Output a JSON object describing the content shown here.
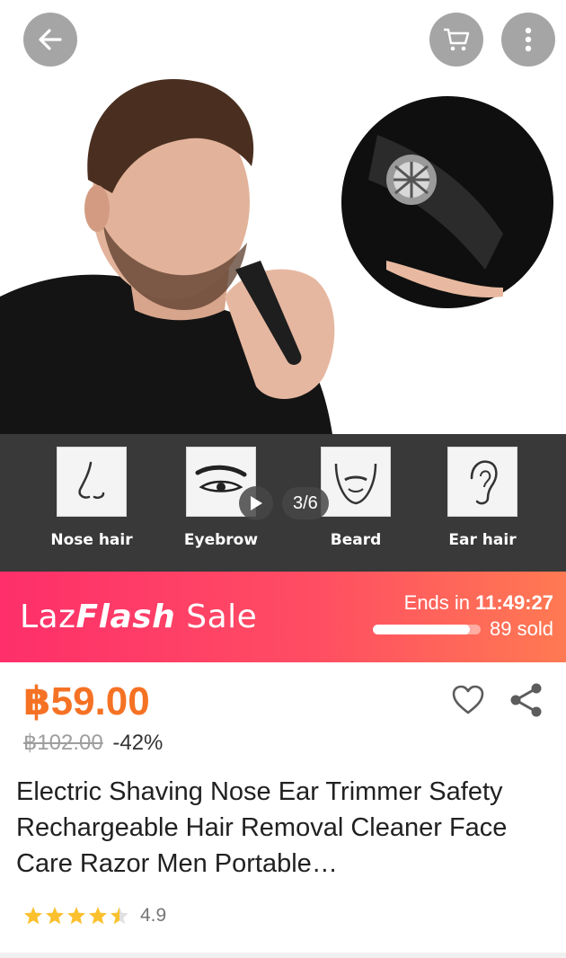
{
  "toolbar": {
    "back_icon": "arrow-left-icon",
    "cart_icon": "cart-icon",
    "more_icon": "vertical-dots-icon"
  },
  "gallery": {
    "counter": "3/6",
    "features": [
      {
        "label": "Nose hair",
        "icon": "nose-icon"
      },
      {
        "label": "Eyebrow",
        "icon": "eyebrow-icon"
      },
      {
        "label": "Beard",
        "icon": "beard-icon"
      },
      {
        "label": "Ear hair",
        "icon": "ear-icon"
      }
    ]
  },
  "flash": {
    "logo_plain": "Laz",
    "logo_bold": "Flash",
    "logo_suffix": " Sale",
    "ends_prefix": "Ends in ",
    "ends_time": "11:49:27",
    "sold": "89 sold",
    "progress": 0.9
  },
  "product": {
    "price": "฿59.00",
    "original_price": "฿102.00",
    "discount": "-42%",
    "title": "Electric Shaving Nose Ear Trimmer Safety Rechargeable Hair Removal Cleaner Face Care Razor Men Portable…",
    "rating": "4.9",
    "stars": 4.5
  },
  "colors": {
    "price": "#f57224",
    "flash_start": "#fe2f6a",
    "flash_end": "#ff7a52",
    "star": "#fbc02d"
  }
}
